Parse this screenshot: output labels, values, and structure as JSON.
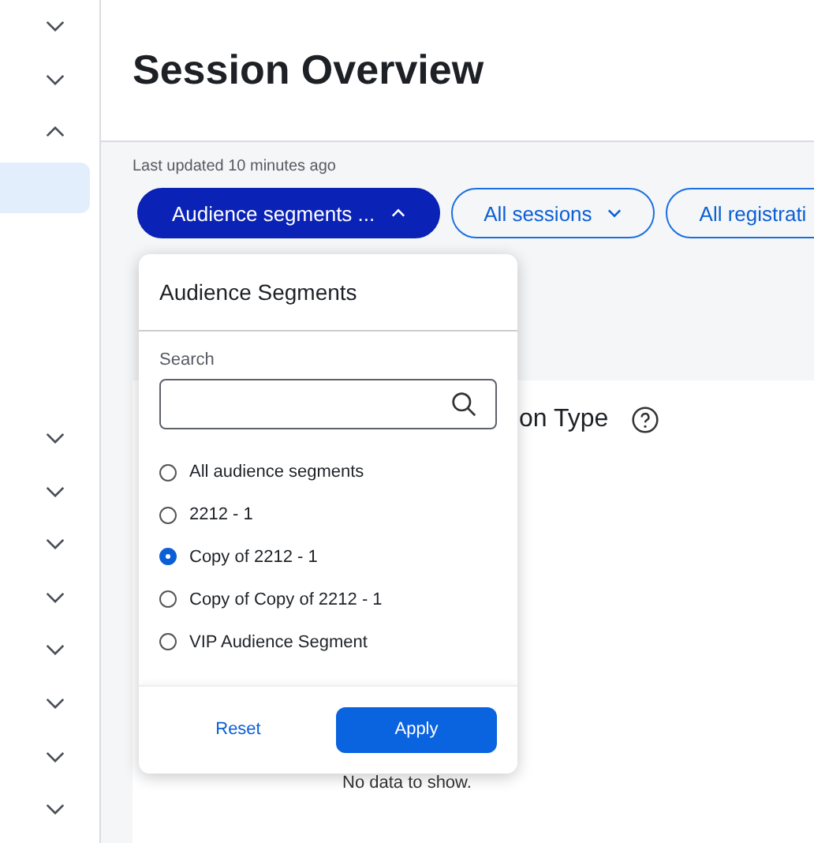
{
  "sidebar": {
    "items": [
      {
        "kind": "toggle",
        "expanded": false
      },
      {
        "kind": "toggle",
        "expanded": false
      },
      {
        "kind": "toggle",
        "expanded": true
      },
      {
        "kind": "link",
        "selected": true
      }
    ],
    "more_items": [
      {
        "kind": "toggle",
        "expanded": false
      },
      {
        "kind": "toggle",
        "expanded": false
      },
      {
        "kind": "toggle",
        "expanded": false
      },
      {
        "kind": "toggle",
        "expanded": false
      },
      {
        "kind": "toggle",
        "expanded": false
      },
      {
        "kind": "toggle",
        "expanded": false
      },
      {
        "kind": "toggle",
        "expanded": false
      },
      {
        "kind": "toggle",
        "expanded": false
      }
    ]
  },
  "page": {
    "title": "Session Overview",
    "last_updated": "Last updated 10 minutes ago"
  },
  "filters": [
    {
      "label": "Audience segments ...",
      "open": true
    },
    {
      "label": "All sessions",
      "open": false
    },
    {
      "label": "All registrati",
      "open": false
    }
  ],
  "card": {
    "title": "on Type",
    "empty_text": "No data to show."
  },
  "dropdown": {
    "title": "Audience Segments",
    "search_label": "Search",
    "options": [
      {
        "label": "All audience segments",
        "selected": false
      },
      {
        "label": "2212 - 1",
        "selected": false
      },
      {
        "label": "Copy of 2212 - 1",
        "selected": true
      },
      {
        "label": "Copy of Copy of 2212 - 1",
        "selected": false
      },
      {
        "label": "VIP Audience Segment",
        "selected": false
      }
    ],
    "reset": "Reset",
    "apply": "Apply"
  }
}
